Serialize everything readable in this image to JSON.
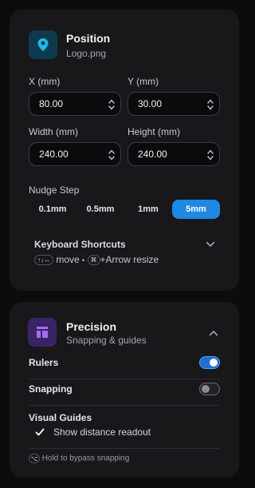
{
  "position": {
    "title": "Position",
    "subtitle": "Logo.png",
    "fields": {
      "x": {
        "label": "X (mm)",
        "value": "80.00"
      },
      "y": {
        "label": "Y (mm)",
        "value": "30.00"
      },
      "width": {
        "label": "Width (mm)",
        "value": "240.00"
      },
      "height": {
        "label": "Height (mm)",
        "value": "240.00"
      }
    },
    "nudge": {
      "label": "Nudge Step",
      "options": [
        "0.1mm",
        "0.5mm",
        "1mm",
        "5mm"
      ],
      "selected": "5mm"
    },
    "shortcuts": {
      "title": "Keyboard Shortcuts",
      "arrows_key": "↑↓↔",
      "move_label": "move",
      "separator": "•",
      "mod_key": "⌘",
      "resize_label": "+Arrow resize"
    }
  },
  "precision": {
    "title": "Precision",
    "subtitle": "Snapping & guides",
    "rulers": {
      "label": "Rulers",
      "on": true
    },
    "snapping": {
      "label": "Snapping",
      "on": false
    },
    "guides": {
      "label": "Visual Guides",
      "option_label": "Show distance readout",
      "checked": true
    },
    "hint_key": "⌥",
    "hint": "Hold to bypass snapping"
  },
  "colors": {
    "accent": "#1e88e5",
    "position_icon_bg": "#0f3a4d",
    "position_icon": "#22b8e8",
    "precision_icon_bg": "#3b2466",
    "precision_icon": "#a46cf0"
  },
  "icons": {
    "position": "map-pin-icon",
    "precision": "layout-icon"
  }
}
